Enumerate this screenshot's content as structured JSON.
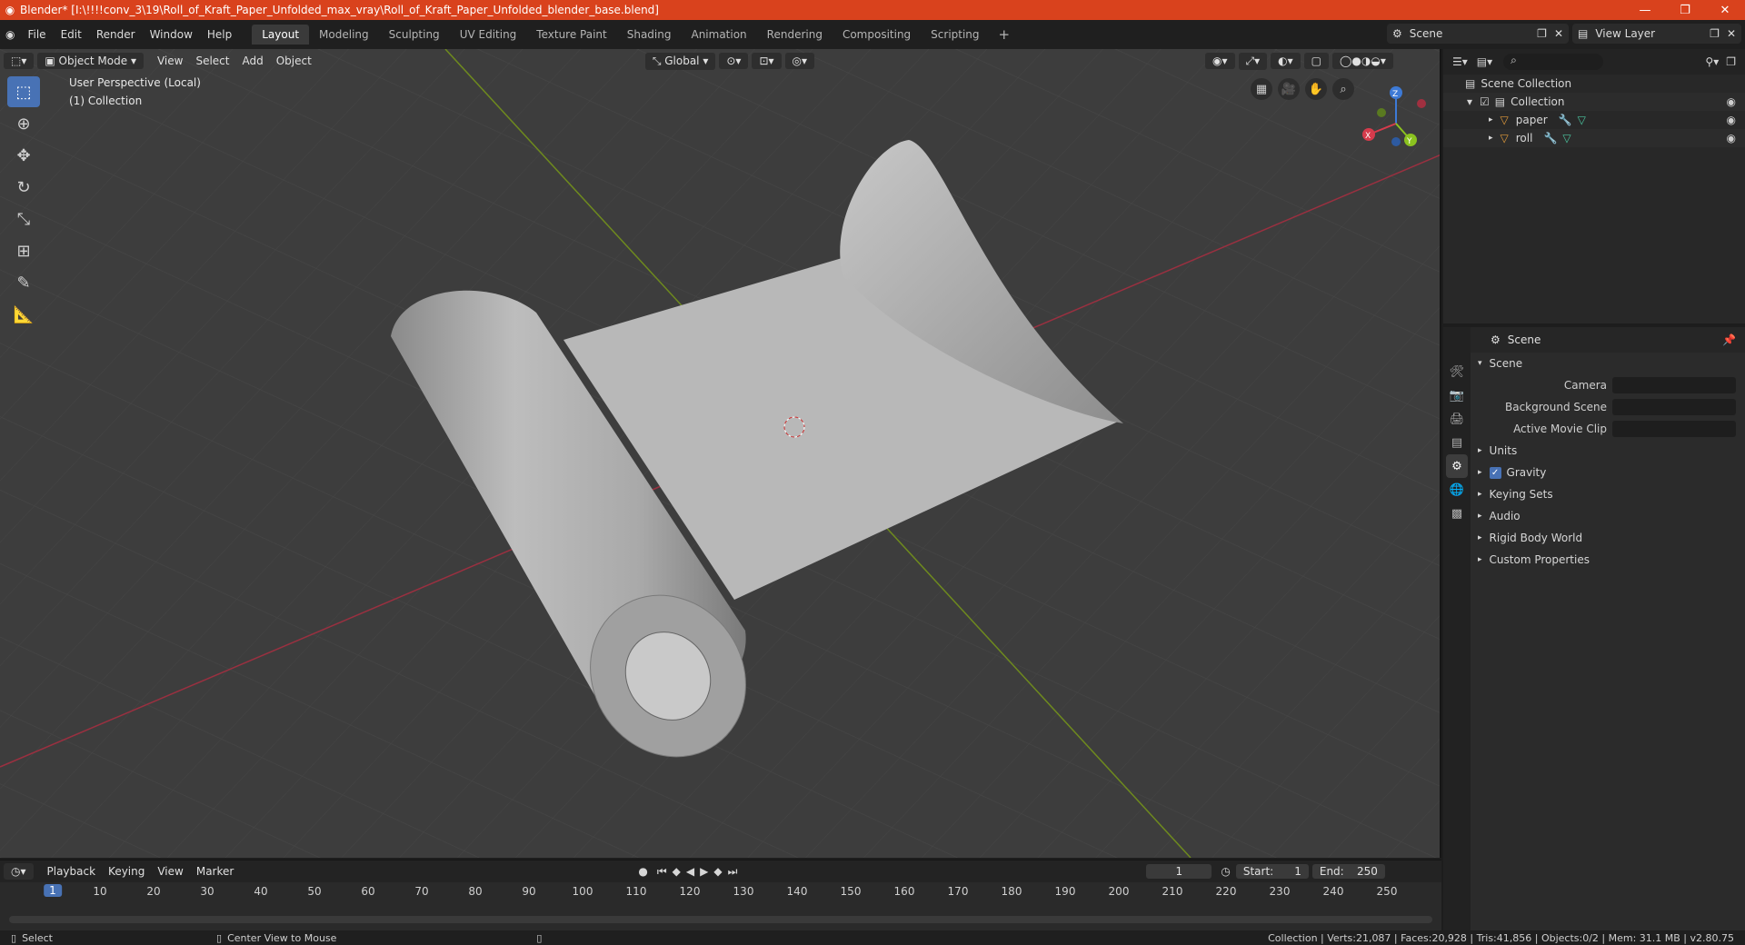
{
  "window": {
    "title": "Blender* [I:\\!!!!conv_3\\19\\Roll_of_Kraft_Paper_Unfolded_max_vray\\Roll_of_Kraft_Paper_Unfolded_blender_base.blend]"
  },
  "menu": [
    "File",
    "Edit",
    "Render",
    "Window",
    "Help"
  ],
  "workspaces": [
    "Layout",
    "Modeling",
    "Sculpting",
    "UV Editing",
    "Texture Paint",
    "Shading",
    "Animation",
    "Rendering",
    "Compositing",
    "Scripting"
  ],
  "active_workspace": "Layout",
  "scene_name": "Scene",
  "view_layer": "View Layer",
  "viewport": {
    "mode": "Object Mode",
    "menus": [
      "View",
      "Select",
      "Add",
      "Object"
    ],
    "orientation": "Global",
    "overlay_line1": "User Perspective (Local)",
    "overlay_line2": "(1) Collection"
  },
  "outliner": {
    "root": "Scene Collection",
    "collection": "Collection",
    "objects": [
      "paper",
      "roll"
    ]
  },
  "properties": {
    "header": "Scene",
    "panel": "Scene",
    "fields": [
      {
        "label": "Camera"
      },
      {
        "label": "Background Scene"
      },
      {
        "label": "Active Movie Clip"
      }
    ],
    "subpanels": [
      "Units",
      "Gravity",
      "Keying Sets",
      "Audio",
      "Rigid Body World",
      "Custom Properties"
    ],
    "gravity_checked": true
  },
  "timeline": {
    "menus": [
      "Playback",
      "Keying",
      "View",
      "Marker"
    ],
    "current_frame": "1",
    "start_label": "Start:",
    "start": "1",
    "end_label": "End:",
    "end": "250",
    "ticks": [
      "10",
      "20",
      "30",
      "40",
      "50",
      "60",
      "70",
      "80",
      "90",
      "100",
      "110",
      "120",
      "130",
      "140",
      "150",
      "160",
      "170",
      "180",
      "190",
      "200",
      "210",
      "220",
      "230",
      "240",
      "250"
    ]
  },
  "status": {
    "left": "Select",
    "middle": "Center View to Mouse",
    "right": "Collection | Verts:21,087 | Faces:20,928 | Tris:41,856 | Objects:0/2 | Mem: 31.1 MB | v2.80.75"
  },
  "colors": {
    "title_bar": "#d9421d",
    "accent": "#4872b5",
    "x_axis": "#b03040",
    "y_axis": "#7a9a20",
    "object_icon": "#e09a3a",
    "mesh_icon": "#4bc6a0"
  }
}
